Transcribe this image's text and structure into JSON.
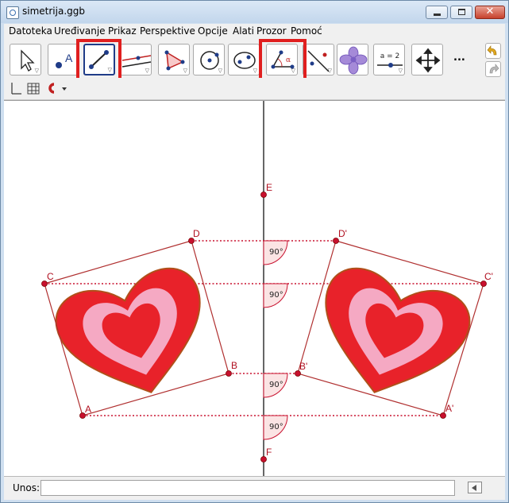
{
  "window": {
    "title": "simetrija.ggb"
  },
  "menu": [
    "Datoteka",
    "Uređivanje",
    "Prikaz",
    "Perspektive",
    "Opcije",
    "Alati",
    "Prozor",
    "Pomoć"
  ],
  "toolbar": {
    "tools": [
      {
        "name": "move-tool",
        "icon": "arrow-cursor-icon",
        "highlighted": false
      },
      {
        "name": "point-tool",
        "icon": "point-A-icon",
        "highlighted": false
      },
      {
        "name": "segment-tool",
        "icon": "segment-icon",
        "highlighted": true,
        "selected": true
      },
      {
        "name": "perpendicular-line-tool",
        "icon": "perpendicular-line-icon",
        "highlighted": false
      },
      {
        "name": "polygon-tool",
        "icon": "polygon-icon",
        "highlighted": false
      },
      {
        "name": "circle-tool",
        "icon": "circle-center-point-icon",
        "highlighted": false
      },
      {
        "name": "conic-tool",
        "icon": "ellipse-icon",
        "highlighted": false
      },
      {
        "name": "angle-tool",
        "icon": "angle-icon",
        "highlighted": true
      },
      {
        "name": "reflect-tool",
        "icon": "reflect-about-line-icon",
        "highlighted": false
      },
      {
        "name": "image-tool",
        "icon": "flower-image-icon",
        "highlighted": false
      },
      {
        "name": "slider-tool",
        "icon": "slider-icon",
        "slider_label": "a = 2",
        "highlighted": false
      },
      {
        "name": "move-graphics-tool",
        "icon": "move-arrows-icon",
        "highlighted": false
      }
    ],
    "more_label": "...",
    "highlight_color": "#e01f1f"
  },
  "stylebar": {
    "icons": [
      "axes-icon",
      "grid-icon",
      "magnet-icon",
      "dropdown-arrow-icon"
    ]
  },
  "geometry": {
    "points": [
      {
        "label": "A"
      },
      {
        "label": "B"
      },
      {
        "label": "C"
      },
      {
        "label": "D"
      },
      {
        "label": "A'"
      },
      {
        "label": "B'"
      },
      {
        "label": "C'"
      },
      {
        "label": "D'"
      },
      {
        "label": "E"
      },
      {
        "label": "F"
      }
    ],
    "angles": [
      "90°",
      "90°",
      "90°",
      "90°"
    ],
    "colors": {
      "point": "#c8102e",
      "polygon": "#b03030",
      "heart_outer": "#e8222a",
      "heart_pink": "#f5a9c3",
      "axis": "#000000"
    }
  },
  "input": {
    "label": "Unos:",
    "value": ""
  }
}
